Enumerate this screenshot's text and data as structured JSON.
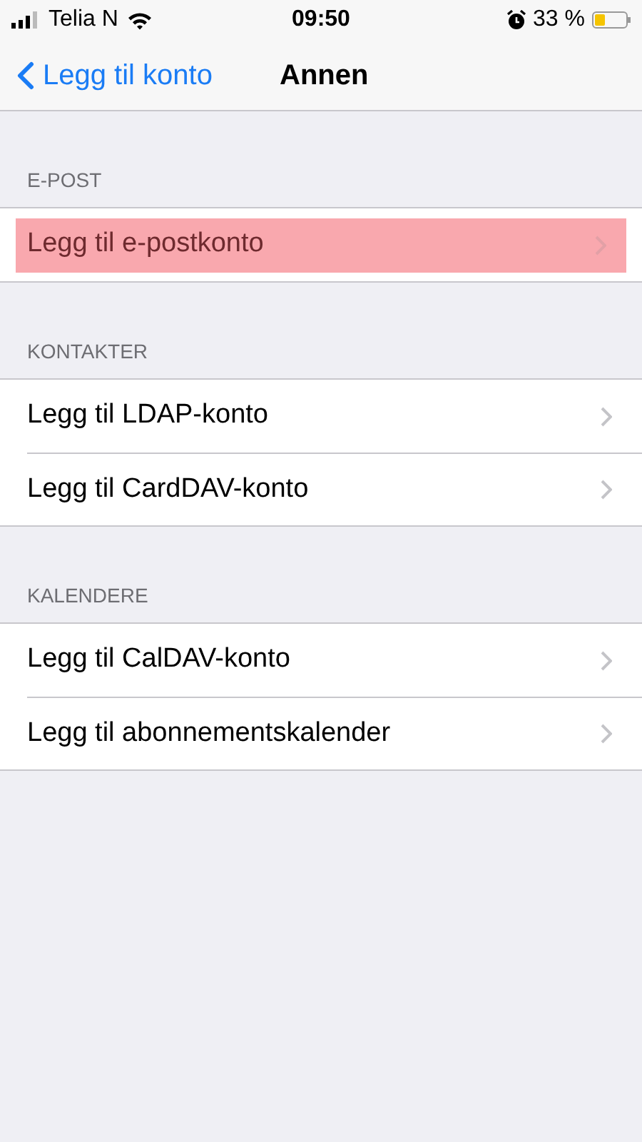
{
  "status_bar": {
    "carrier": "Telia N",
    "time": "09:50",
    "battery": "33 %"
  },
  "nav": {
    "back": "Legg til konto",
    "title": "Annen"
  },
  "sections": [
    {
      "header": "E-POST",
      "rows": [
        {
          "label": "Legg til e-postkonto",
          "highlighted": true
        }
      ]
    },
    {
      "header": "KONTAKTER",
      "rows": [
        {
          "label": "Legg til LDAP-konto",
          "highlighted": false
        },
        {
          "label": "Legg til CardDAV-konto",
          "highlighted": false
        }
      ]
    },
    {
      "header": "KALENDERE",
      "rows": [
        {
          "label": "Legg til CalDAV-konto",
          "highlighted": false
        },
        {
          "label": "Legg til abonnementskalender",
          "highlighted": false
        }
      ]
    }
  ]
}
